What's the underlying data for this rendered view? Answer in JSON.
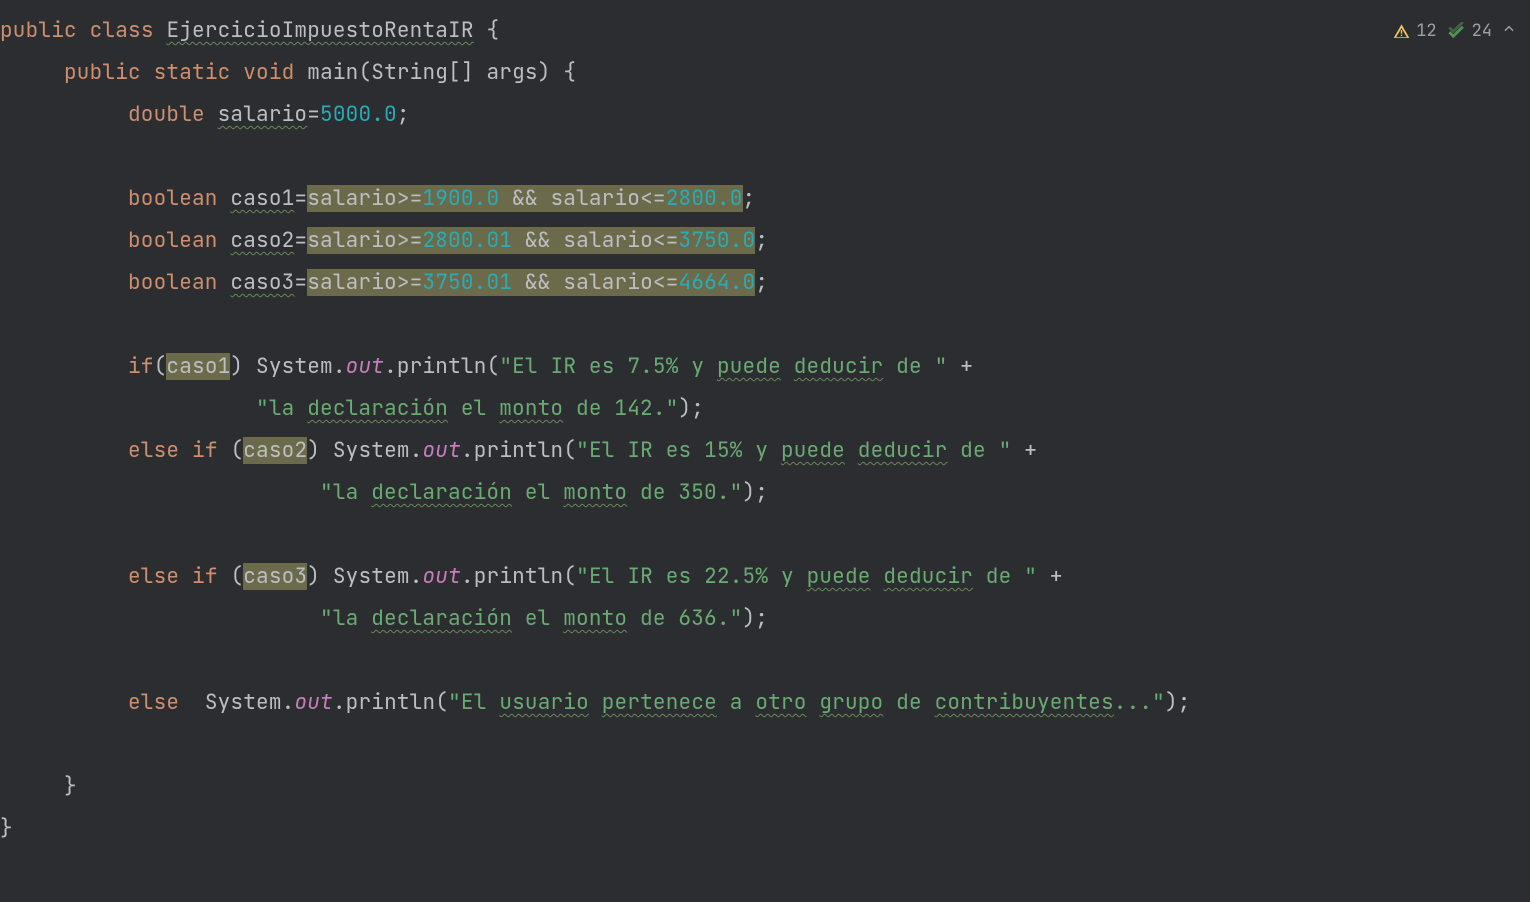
{
  "status": {
    "warnings": "12",
    "checks": "24"
  },
  "code": {
    "kw_public": "public",
    "kw_class": "class",
    "kw_static": "static",
    "kw_void": "void",
    "kw_double": "double",
    "kw_boolean": "boolean",
    "kw_if": "if",
    "kw_else": "else",
    "cls": "EjercicioImpuestoRentaIR",
    "main": "main",
    "args": "String[] args",
    "System": "System",
    "out": "out",
    "println": "println",
    "salario": "salario",
    "eq": "=",
    "v5000": "5000.0",
    "semi": ";",
    "sp": " ",
    "caso1": "caso1",
    "caso2": "caso2",
    "caso3": "caso3",
    "ge": ">=",
    "le": "<=",
    "and": "&&",
    "v1900": "1900.0",
    "v2800": "2800.0",
    "v2800_01": "2800.01",
    "v3750": "3750.0",
    "v3750_01": "3750.01",
    "v4664": "4664.0",
    "op": "(",
    "cp": ")",
    "ob": "{",
    "cb": "}",
    "dot": ".",
    "plus": "+",
    "q": "\"",
    "s1a": "El IR es 7.5% y ",
    "s1a2": "puede",
    "s1a3": " ",
    "s1a4": "deducir",
    "s1a5": " de ",
    "s1b": "la ",
    "s1b2": "declaración",
    "s1b3": " el ",
    "s1b4": "monto",
    "s1b5": " de 142.",
    "s2a": "El IR es 15% y ",
    "s2a2": "puede",
    "s2a3": " ",
    "s2a4": "deducir",
    "s2a5": " de ",
    "s2b": "la ",
    "s2b2": "declaración",
    "s2b3": " el ",
    "s2b4": "monto",
    "s2b5": " de 350.",
    "s3a": "El IR es 22.5% y ",
    "s3a2": "puede",
    "s3a3": " ",
    "s3a4": "deducir",
    "s3a5": " de ",
    "s3b": "la ",
    "s3b2": "declaración",
    "s3b3": " el ",
    "s3b4": "monto",
    "s3b5": " de 636.",
    "s4": "El ",
    "s4a": "usuario",
    "s4b": " ",
    "s4c": "pertenece",
    "s4d": " a ",
    "s4e": "otro",
    "s4f": " ",
    "s4g": "grupo",
    "s4h": " de ",
    "s4i": "contribuyentes",
    "s4j": "...",
    "ind0": "",
    "ind1": "     ",
    "ind2": "          ",
    "ind3": "                    ",
    "ind3b": "                         "
  }
}
